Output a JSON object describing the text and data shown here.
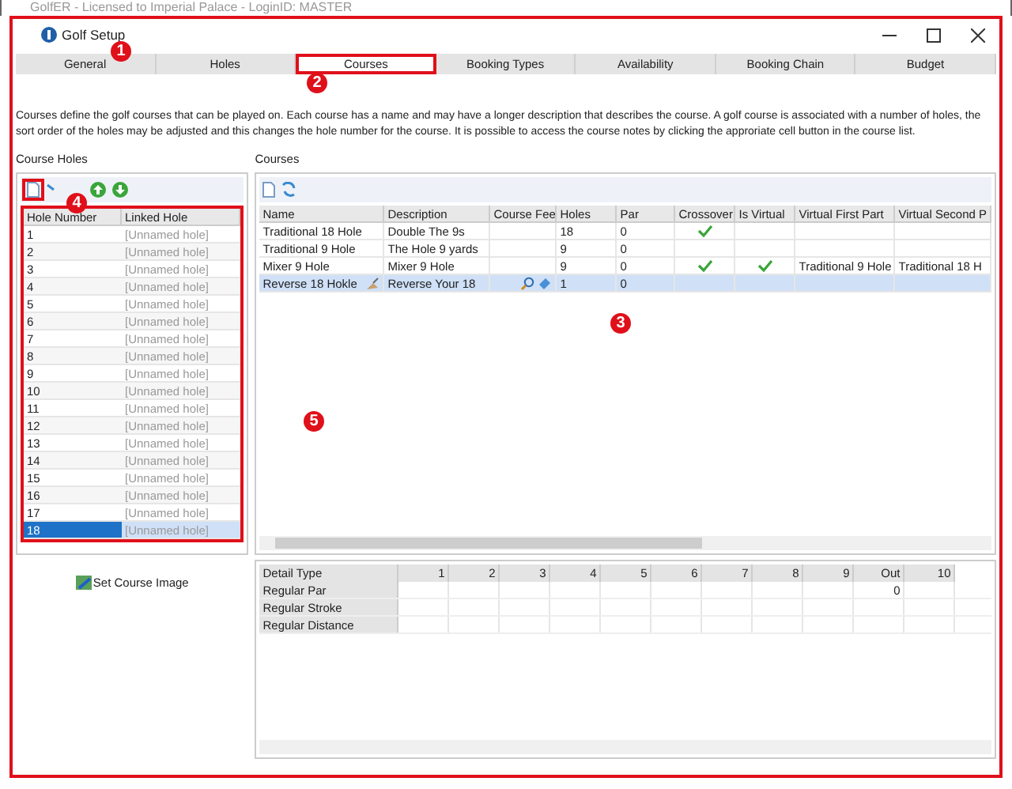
{
  "background_window": {
    "title": "GolfER - Licensed to Imperial Palace - LoginID: MASTER"
  },
  "window": {
    "title": "Golf Setup"
  },
  "tabs": [
    {
      "label": "General",
      "selected": false
    },
    {
      "label": "Holes",
      "selected": false
    },
    {
      "label": "Courses",
      "selected": true
    },
    {
      "label": "Booking Types",
      "selected": false
    },
    {
      "label": "Availability",
      "selected": false
    },
    {
      "label": "Booking Chain",
      "selected": false
    },
    {
      "label": "Budget",
      "selected": false
    }
  ],
  "description": "Courses define the golf courses that can be played on. Each course has a name and may have a longer description that describes the course. A golf course is associated with a number of holes, the sort order of the holes may be adjusted and this changes the hole number for the course. It is possible to access the course notes by clicking the approriate cell button in the course list.",
  "course_holes": {
    "title": "Course Holes",
    "columns": [
      "Hole Number",
      "Linked Hole"
    ],
    "rows": [
      {
        "number": "1",
        "linked": "[Unnamed hole]",
        "selected": false
      },
      {
        "number": "2",
        "linked": "[Unnamed hole]",
        "selected": false
      },
      {
        "number": "3",
        "linked": "[Unnamed hole]",
        "selected": false
      },
      {
        "number": "4",
        "linked": "[Unnamed hole]",
        "selected": false
      },
      {
        "number": "5",
        "linked": "[Unnamed hole]",
        "selected": false
      },
      {
        "number": "6",
        "linked": "[Unnamed hole]",
        "selected": false
      },
      {
        "number": "7",
        "linked": "[Unnamed hole]",
        "selected": false
      },
      {
        "number": "8",
        "linked": "[Unnamed hole]",
        "selected": false
      },
      {
        "number": "9",
        "linked": "[Unnamed hole]",
        "selected": false
      },
      {
        "number": "10",
        "linked": "[Unnamed hole]",
        "selected": false
      },
      {
        "number": "11",
        "linked": "[Unnamed hole]",
        "selected": false
      },
      {
        "number": "12",
        "linked": "[Unnamed hole]",
        "selected": false
      },
      {
        "number": "13",
        "linked": "[Unnamed hole]",
        "selected": false
      },
      {
        "number": "14",
        "linked": "[Unnamed hole]",
        "selected": false
      },
      {
        "number": "15",
        "linked": "[Unnamed hole]",
        "selected": false
      },
      {
        "number": "16",
        "linked": "[Unnamed hole]",
        "selected": false
      },
      {
        "number": "17",
        "linked": "[Unnamed hole]",
        "selected": false
      },
      {
        "number": "18",
        "linked": "[Unnamed hole]",
        "selected": true
      }
    ]
  },
  "set_course_image": "Set Course Image",
  "courses": {
    "title": "Courses",
    "columns": [
      "Name",
      "Description",
      "Course Fee",
      "Holes",
      "Par",
      "Crossover",
      "Is Virtual",
      "Virtual First Part",
      "Virtual Second P"
    ],
    "rows": [
      {
        "name": "Traditional 18 Hole",
        "description": "Double The 9s",
        "holes": "18",
        "par": "0",
        "crossover": true,
        "is_virtual": false,
        "selected": false
      },
      {
        "name": "Traditional 9 Hole",
        "description": "The Hole 9 yards",
        "holes": "9",
        "par": "0",
        "crossover": false,
        "is_virtual": false,
        "selected": false
      },
      {
        "name": "Mixer 9 Hole",
        "description": "Mixer 9 Hole",
        "holes": "9",
        "par": "0",
        "crossover": true,
        "is_virtual": true,
        "virtual_first_part": "Traditional 9 Hole",
        "virtual_second_part": "Traditional 18 H",
        "selected": false
      },
      {
        "name": "Reverse 18 Hokle",
        "description": "Reverse Your 18",
        "holes": "1",
        "par": "0",
        "crossover": false,
        "is_virtual": false,
        "selected": true
      }
    ]
  },
  "details": {
    "columns": [
      "Detail Type",
      "1",
      "2",
      "3",
      "4",
      "5",
      "6",
      "7",
      "8",
      "9",
      "Out",
      "10"
    ],
    "rows": [
      {
        "cells": [
          "Regular Par",
          "",
          "",
          "",
          "",
          "",
          "",
          "",
          "",
          "",
          "0",
          ""
        ]
      },
      {
        "cells": [
          "Regular Stroke",
          "",
          "",
          "",
          "",
          "",
          "",
          "",
          "",
          "",
          "",
          ""
        ]
      },
      {
        "cells": [
          "Regular Distance",
          "",
          "",
          "",
          "",
          "",
          "",
          "",
          "",
          "",
          "",
          ""
        ]
      }
    ]
  },
  "annotations": [
    "1",
    "2",
    "3",
    "4",
    "5"
  ]
}
